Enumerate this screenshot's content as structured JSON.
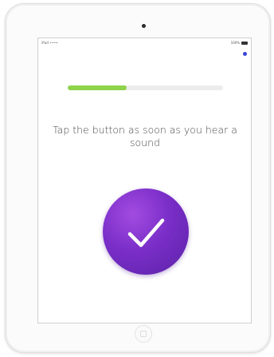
{
  "status_bar": {
    "carrier": "iPad ••••",
    "battery": "100%"
  },
  "progress": {
    "value_percent": 38,
    "fill_color": "#8ed34a",
    "track_color": "#ececec"
  },
  "instruction": {
    "text": "Tap the button as soon as you hear a sound"
  },
  "tap_button": {
    "icon": "checkmark-icon",
    "color": "#7a2ec8"
  },
  "menu": {
    "icon": "menu-dot-icon",
    "color": "#3a43d6"
  }
}
